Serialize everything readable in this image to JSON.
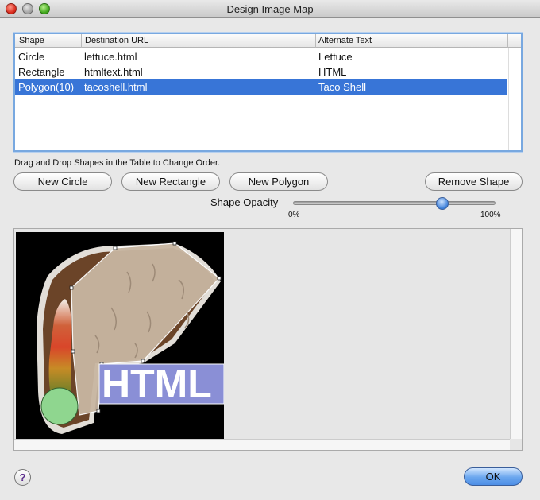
{
  "window": {
    "title": "Design Image Map"
  },
  "table": {
    "columns": [
      "Shape",
      "Destination URL",
      "Alternate Text"
    ],
    "rows": [
      {
        "shape": "Circle",
        "url": "lettuce.html",
        "alt": "Lettuce",
        "selected": false
      },
      {
        "shape": "Rectangle",
        "url": "htmltext.html",
        "alt": "HTML",
        "selected": false
      },
      {
        "shape": "Polygon(10)",
        "url": "tacoshell.html",
        "alt": "Taco Shell",
        "selected": true
      }
    ]
  },
  "hint": "Drag and Drop Shapes in the Table to Change Order.",
  "buttons": {
    "new_circle": "New Circle",
    "new_rectangle": "New Rectangle",
    "new_polygon": "New Polygon",
    "remove_shape": "Remove Shape",
    "ok": "OK",
    "help": "?"
  },
  "opacity": {
    "label": "Shape Opacity",
    "min_label": "0%",
    "max_label": "100%",
    "value": 0.73
  },
  "image": {
    "text": "HTML"
  },
  "colors": {
    "selection": "#3875d7",
    "focus_ring": "#78a8e0",
    "overlay": "#8a8fd6",
    "circle_overlay": "#8fd68f"
  }
}
